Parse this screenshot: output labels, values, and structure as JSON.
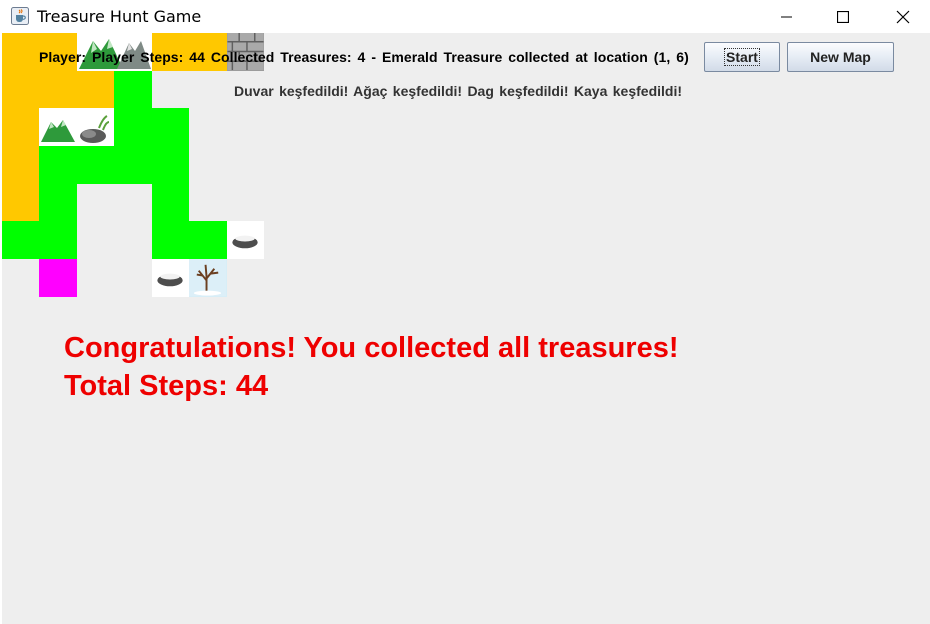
{
  "window": {
    "title": "Treasure Hunt Game",
    "app_icon": "java-coffee-cup-icon",
    "controls": [
      "minimize-icon",
      "maximize-icon",
      "close-icon"
    ]
  },
  "status_bar": {
    "text": "Player: Player  Steps: 44  Collected Treasures: 4 - Emerald Treasure collected at location (1, 6)"
  },
  "discoveries": {
    "text": "Duvar keşfedildi!  Ağaç keşfedildi!  Dag keşfedildi!  Kaya keşfedildi!"
  },
  "buttons": {
    "start": "Start",
    "new_map": "New Map"
  },
  "result": {
    "message": "Congratulations! You collected all treasures!",
    "total_steps": "Total Steps: 44"
  },
  "map": {
    "colors": {
      "visited_path": "#ffc800",
      "discovered_area": "#00ff00",
      "player": "#ff00ff",
      "background": "#eeeeee"
    },
    "legend_tiles": {
      "mountain": "mountain-icon",
      "rock": "rock-icon",
      "wall": "wall-icon",
      "snow_rock": "snow-rock-icon",
      "snow_tree": "snow-tree-icon"
    }
  }
}
